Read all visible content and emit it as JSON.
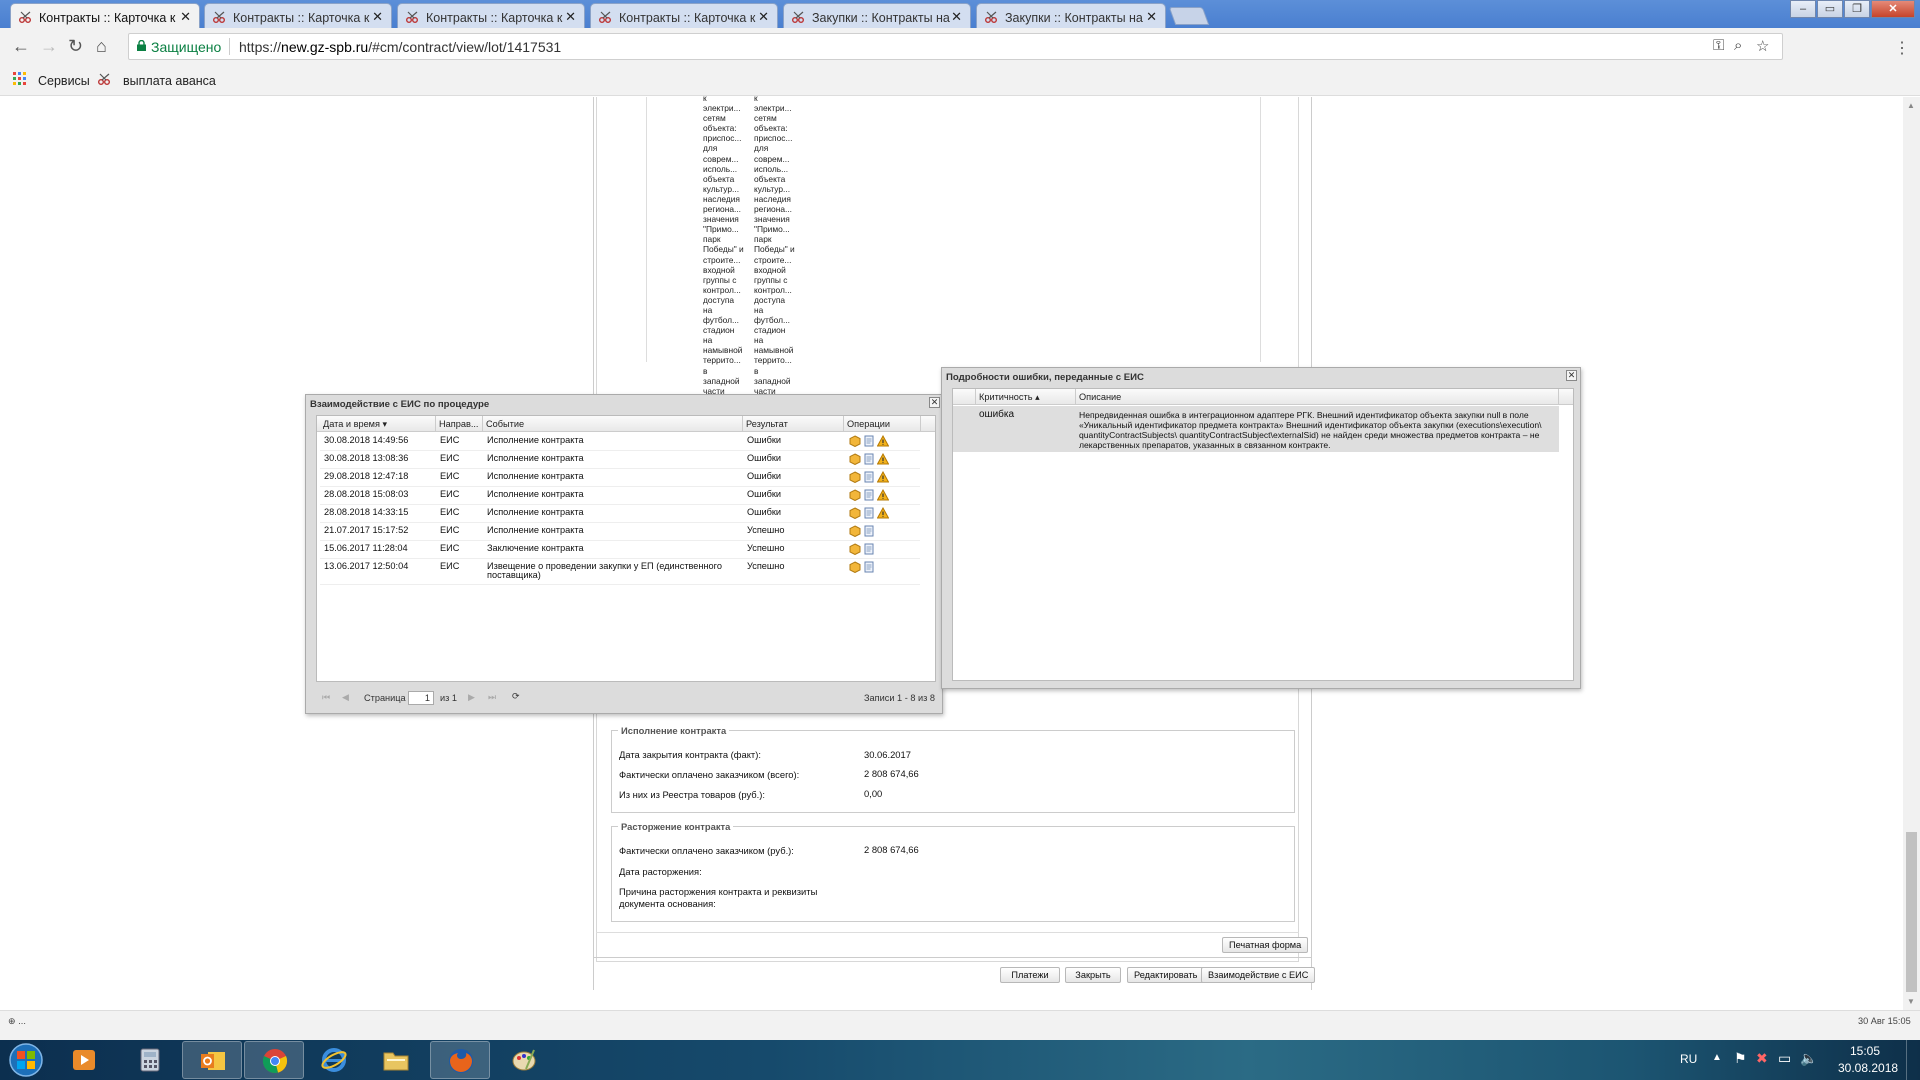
{
  "browser": {
    "tabs": [
      {
        "title": "Контракты :: Карточка к"
      },
      {
        "title": "Контракты :: Карточка к"
      },
      {
        "title": "Контракты :: Карточка к"
      },
      {
        "title": "Контракты :: Карточка к"
      },
      {
        "title": "Закупки :: Контракты на"
      },
      {
        "title": "Закупки :: Контракты на"
      }
    ],
    "secure_label": "Защищено",
    "url_prefix": "https://",
    "url_host": "new.gz-spb.ru",
    "url_path": "/#cm/contract/view/lot/1417531",
    "bookmarks": [
      {
        "label": "Сервисы"
      },
      {
        "label": "выплата аванса"
      }
    ]
  },
  "subject_text": {
    "col1": "к\nэлектри...\nсетям\nобъекта:\nприспос...\nдля\nсоврем...\nисполь...\nобъекта\nкультур...\nнаследия\nрегиона...\nзначения\n\"Примо...\nпарк\nПобеды\" и\nстроите...\nвходной\nгруппы с\nконтрол...\nдоступа\nна\nфутбол...\nстадион\nна\nнамывной\nтеррито...\nв\nзападной\nчасти",
    "col2": "к\nэлектри...\nсетям\nобъекта:\nприспос...\nдля\nсоврем...\nисполь...\nобъекта\nкультур...\nнаследия\nрегиона...\nзначения\n\"Примо...\nпарк\nПобеды\" и\nстроите...\nвходной\nгруппы с\nконтрол...\nдоступа\nна\nфутбол...\nстадион\nна\nнамывной\nтеррито...\nв\nзападной\nчасти"
  },
  "execution": {
    "legend": "Исполнение контракта",
    "rows": [
      {
        "label": "Дата закрытия контракта (факт):",
        "value": "30.06.2017"
      },
      {
        "label": "Фактически оплачено заказчиком (всего):",
        "value": "2 808 674,66"
      },
      {
        "label": "Из них из Реестра товаров (руб.):",
        "value": "0,00"
      }
    ]
  },
  "termination": {
    "legend": "Расторжение контракта",
    "rows": [
      {
        "label": "Фактически оплачено заказчиком (руб.):",
        "value": "2 808 674,66"
      },
      {
        "label": "Дата расторжения:",
        "value": ""
      },
      {
        "label": "Причина расторжения контракта и реквизиты документа основания:",
        "value": ""
      }
    ]
  },
  "card_buttons": {
    "print": "Печатная форма",
    "payments": "Платежи",
    "close": "Закрыть",
    "edit": "Редактировать",
    "eis": "Взаимодействие с ЕИС"
  },
  "eis_window": {
    "title": "Взаимодействие с ЕИС по процедуре",
    "columns": [
      "Дата и время",
      "Направ...",
      "Событие",
      "Результат",
      "Операции"
    ],
    "sort_indicator": "▾",
    "rows": [
      {
        "date": "30.08.2018 14:49:56",
        "dir": "ЕИС",
        "event": "Исполнение контракта",
        "result": "Ошибки",
        "warn": true
      },
      {
        "date": "30.08.2018 13:08:36",
        "dir": "ЕИС",
        "event": "Исполнение контракта",
        "result": "Ошибки",
        "warn": true
      },
      {
        "date": "29.08.2018 12:47:18",
        "dir": "ЕИС",
        "event": "Исполнение контракта",
        "result": "Ошибки",
        "warn": true
      },
      {
        "date": "28.08.2018 15:08:03",
        "dir": "ЕИС",
        "event": "Исполнение контракта",
        "result": "Ошибки",
        "warn": true
      },
      {
        "date": "28.08.2018 14:33:15",
        "dir": "ЕИС",
        "event": "Исполнение контракта",
        "result": "Ошибки",
        "warn": true
      },
      {
        "date": "21.07.2017 15:17:52",
        "dir": "ЕИС",
        "event": "Исполнение контракта",
        "result": "Успешно",
        "warn": false
      },
      {
        "date": "15.06.2017 11:28:04",
        "dir": "ЕИС",
        "event": "Заключение контракта",
        "result": "Успешно",
        "warn": false
      },
      {
        "date": "13.06.2017 12:50:04",
        "dir": "ЕИС",
        "event": "Извещение о проведении закупки у ЕП (единственного поставщика)",
        "result": "Успешно",
        "warn": false
      }
    ],
    "pager": {
      "page_label": "Страница",
      "page_value": "1",
      "of_label": "из 1",
      "records": "Записи 1 - 8 из 8"
    }
  },
  "error_window": {
    "title": "Подробности ошибки, переданные с ЕИС",
    "columns": [
      "Критичность",
      "Описание"
    ],
    "sort_indicator": "▴",
    "row": {
      "severity": "ошибка",
      "description": "Непредвиденная ошибка в интеграционном адаптере РГК. Внешний идентификатор объекта закупки null в поле «Уникальный идентификатор предмета контракта» Внешний идентификатор объекта закупки (executions\\execution\\ quantityContractSubjects\\ quantityContractSubject\\externalSid) не найден среди множества предметов контракта – не лекарственных препаратов, указанных в связанном контракте."
    }
  },
  "status": {
    "left": "⊕ ...",
    "right": "30 Авг 15:05"
  },
  "taskbar": {
    "lang": "RU",
    "time": "15:05",
    "date": "30.08.2018"
  }
}
